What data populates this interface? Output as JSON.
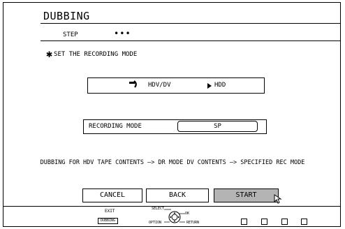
{
  "header": {
    "title": "DUBBING",
    "step_label": "STEP",
    "step_dots": "•••"
  },
  "instruction": {
    "icon": "asterisk-icon",
    "text": "SET THE RECORDING MODE"
  },
  "source_dest": {
    "source": "HDV/DV",
    "dest": "HDD"
  },
  "recording_mode": {
    "label": "RECORDING MODE",
    "value": "SP"
  },
  "info_text": "DUBBING FOR HDV TAPE CONTENTS —> DR MODE  DV CONTENTS —> SPECIFIED REC MODE",
  "buttons": {
    "cancel": "CANCEL",
    "back": "BACK",
    "start": "START"
  },
  "footer": {
    "exit": "EXIT",
    "mode_badge": "DUBBING",
    "select": "SELECT",
    "ok": "OK",
    "option": "OPTION",
    "return": "RETURN"
  },
  "colors": {
    "start_button_bg": "#b4b4b4",
    "line": "#000000",
    "background": "#ffffff"
  }
}
